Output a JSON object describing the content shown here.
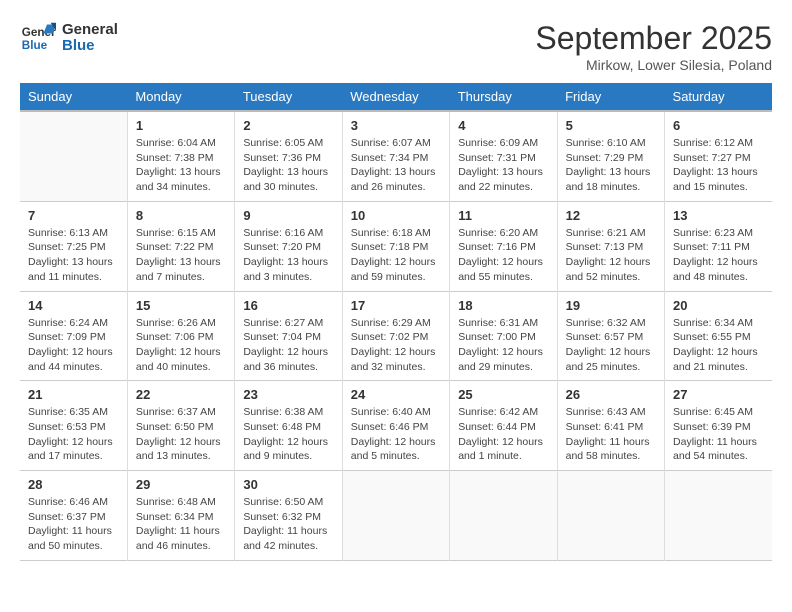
{
  "header": {
    "logo_line1": "General",
    "logo_line2": "Blue",
    "month": "September 2025",
    "location": "Mirkow, Lower Silesia, Poland"
  },
  "days_of_week": [
    "Sunday",
    "Monday",
    "Tuesday",
    "Wednesday",
    "Thursday",
    "Friday",
    "Saturday"
  ],
  "weeks": [
    [
      {
        "num": "",
        "info": ""
      },
      {
        "num": "1",
        "info": "Sunrise: 6:04 AM\nSunset: 7:38 PM\nDaylight: 13 hours\nand 34 minutes."
      },
      {
        "num": "2",
        "info": "Sunrise: 6:05 AM\nSunset: 7:36 PM\nDaylight: 13 hours\nand 30 minutes."
      },
      {
        "num": "3",
        "info": "Sunrise: 6:07 AM\nSunset: 7:34 PM\nDaylight: 13 hours\nand 26 minutes."
      },
      {
        "num": "4",
        "info": "Sunrise: 6:09 AM\nSunset: 7:31 PM\nDaylight: 13 hours\nand 22 minutes."
      },
      {
        "num": "5",
        "info": "Sunrise: 6:10 AM\nSunset: 7:29 PM\nDaylight: 13 hours\nand 18 minutes."
      },
      {
        "num": "6",
        "info": "Sunrise: 6:12 AM\nSunset: 7:27 PM\nDaylight: 13 hours\nand 15 minutes."
      }
    ],
    [
      {
        "num": "7",
        "info": "Sunrise: 6:13 AM\nSunset: 7:25 PM\nDaylight: 13 hours\nand 11 minutes."
      },
      {
        "num": "8",
        "info": "Sunrise: 6:15 AM\nSunset: 7:22 PM\nDaylight: 13 hours\nand 7 minutes."
      },
      {
        "num": "9",
        "info": "Sunrise: 6:16 AM\nSunset: 7:20 PM\nDaylight: 13 hours\nand 3 minutes."
      },
      {
        "num": "10",
        "info": "Sunrise: 6:18 AM\nSunset: 7:18 PM\nDaylight: 12 hours\nand 59 minutes."
      },
      {
        "num": "11",
        "info": "Sunrise: 6:20 AM\nSunset: 7:16 PM\nDaylight: 12 hours\nand 55 minutes."
      },
      {
        "num": "12",
        "info": "Sunrise: 6:21 AM\nSunset: 7:13 PM\nDaylight: 12 hours\nand 52 minutes."
      },
      {
        "num": "13",
        "info": "Sunrise: 6:23 AM\nSunset: 7:11 PM\nDaylight: 12 hours\nand 48 minutes."
      }
    ],
    [
      {
        "num": "14",
        "info": "Sunrise: 6:24 AM\nSunset: 7:09 PM\nDaylight: 12 hours\nand 44 minutes."
      },
      {
        "num": "15",
        "info": "Sunrise: 6:26 AM\nSunset: 7:06 PM\nDaylight: 12 hours\nand 40 minutes."
      },
      {
        "num": "16",
        "info": "Sunrise: 6:27 AM\nSunset: 7:04 PM\nDaylight: 12 hours\nand 36 minutes."
      },
      {
        "num": "17",
        "info": "Sunrise: 6:29 AM\nSunset: 7:02 PM\nDaylight: 12 hours\nand 32 minutes."
      },
      {
        "num": "18",
        "info": "Sunrise: 6:31 AM\nSunset: 7:00 PM\nDaylight: 12 hours\nand 29 minutes."
      },
      {
        "num": "19",
        "info": "Sunrise: 6:32 AM\nSunset: 6:57 PM\nDaylight: 12 hours\nand 25 minutes."
      },
      {
        "num": "20",
        "info": "Sunrise: 6:34 AM\nSunset: 6:55 PM\nDaylight: 12 hours\nand 21 minutes."
      }
    ],
    [
      {
        "num": "21",
        "info": "Sunrise: 6:35 AM\nSunset: 6:53 PM\nDaylight: 12 hours\nand 17 minutes."
      },
      {
        "num": "22",
        "info": "Sunrise: 6:37 AM\nSunset: 6:50 PM\nDaylight: 12 hours\nand 13 minutes."
      },
      {
        "num": "23",
        "info": "Sunrise: 6:38 AM\nSunset: 6:48 PM\nDaylight: 12 hours\nand 9 minutes."
      },
      {
        "num": "24",
        "info": "Sunrise: 6:40 AM\nSunset: 6:46 PM\nDaylight: 12 hours\nand 5 minutes."
      },
      {
        "num": "25",
        "info": "Sunrise: 6:42 AM\nSunset: 6:44 PM\nDaylight: 12 hours\nand 1 minute."
      },
      {
        "num": "26",
        "info": "Sunrise: 6:43 AM\nSunset: 6:41 PM\nDaylight: 11 hours\nand 58 minutes."
      },
      {
        "num": "27",
        "info": "Sunrise: 6:45 AM\nSunset: 6:39 PM\nDaylight: 11 hours\nand 54 minutes."
      }
    ],
    [
      {
        "num": "28",
        "info": "Sunrise: 6:46 AM\nSunset: 6:37 PM\nDaylight: 11 hours\nand 50 minutes."
      },
      {
        "num": "29",
        "info": "Sunrise: 6:48 AM\nSunset: 6:34 PM\nDaylight: 11 hours\nand 46 minutes."
      },
      {
        "num": "30",
        "info": "Sunrise: 6:50 AM\nSunset: 6:32 PM\nDaylight: 11 hours\nand 42 minutes."
      },
      {
        "num": "",
        "info": ""
      },
      {
        "num": "",
        "info": ""
      },
      {
        "num": "",
        "info": ""
      },
      {
        "num": "",
        "info": ""
      }
    ]
  ]
}
